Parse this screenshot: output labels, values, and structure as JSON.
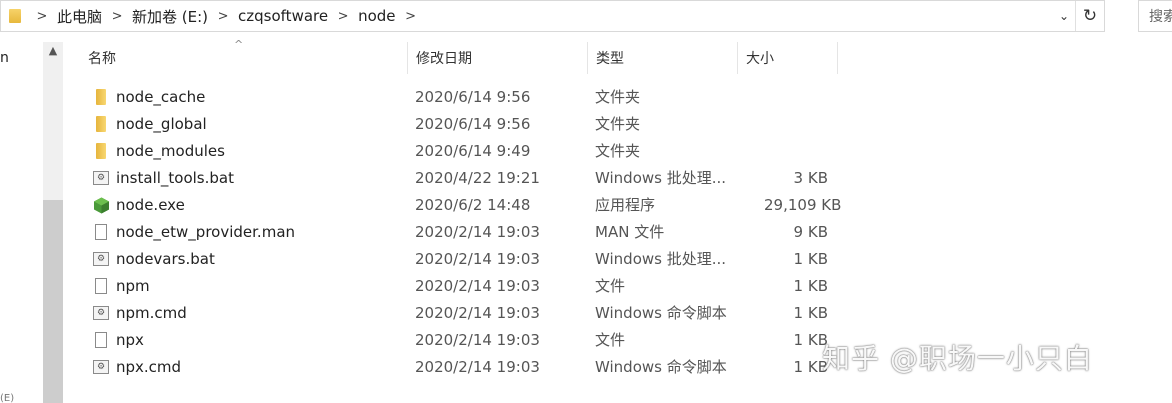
{
  "address": {
    "crumbs": [
      "此电脑",
      "新加卷 (E:)",
      "czqsoftware",
      "node"
    ],
    "separator": ">",
    "dropdown_icon": "chevron-down-icon",
    "refresh_icon": "refresh-icon"
  },
  "search": {
    "placeholder": "搜索"
  },
  "nav": {
    "partial_label": "n",
    "bottom_partial": "(E)"
  },
  "columns": {
    "name": "名称",
    "date": "修改日期",
    "type": "类型",
    "size": "大小"
  },
  "files": [
    {
      "name": "node_cache",
      "date": "2020/6/14 9:56",
      "type": "文件夹",
      "size": "",
      "icon": "folder"
    },
    {
      "name": "node_global",
      "date": "2020/6/14 9:56",
      "type": "文件夹",
      "size": "",
      "icon": "folder"
    },
    {
      "name": "node_modules",
      "date": "2020/6/14 9:49",
      "type": "文件夹",
      "size": "",
      "icon": "folder"
    },
    {
      "name": "install_tools.bat",
      "date": "2020/4/22 19:21",
      "type": "Windows 批处理...",
      "size": "3 KB",
      "icon": "bat"
    },
    {
      "name": "node.exe",
      "date": "2020/6/2 14:48",
      "type": "应用程序",
      "size": "29,109 KB",
      "icon": "exe"
    },
    {
      "name": "node_etw_provider.man",
      "date": "2020/2/14 19:03",
      "type": "MAN 文件",
      "size": "9 KB",
      "icon": "file"
    },
    {
      "name": "nodevars.bat",
      "date": "2020/2/14 19:03",
      "type": "Windows 批处理...",
      "size": "1 KB",
      "icon": "bat"
    },
    {
      "name": "npm",
      "date": "2020/2/14 19:03",
      "type": "文件",
      "size": "1 KB",
      "icon": "file"
    },
    {
      "name": "npm.cmd",
      "date": "2020/2/14 19:03",
      "type": "Windows 命令脚本",
      "size": "1 KB",
      "icon": "bat"
    },
    {
      "name": "npx",
      "date": "2020/2/14 19:03",
      "type": "文件",
      "size": "1 KB",
      "icon": "file"
    },
    {
      "name": "npx.cmd",
      "date": "2020/2/14 19:03",
      "type": "Windows 命令脚本",
      "size": "1 KB",
      "icon": "bat"
    }
  ],
  "watermark": "知乎 @职场一小只白",
  "colors": {
    "folder": "#f2c75c",
    "exe": "#4a9a3a",
    "scrollbar": "#cdcdcd"
  }
}
